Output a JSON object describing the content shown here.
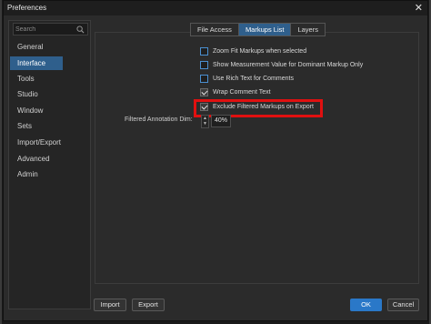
{
  "window": {
    "title": "Preferences",
    "close_glyph": "✕"
  },
  "search": {
    "placeholder": "Search",
    "icon": "search-icon"
  },
  "sidebar": {
    "items": [
      {
        "label": "General",
        "active": false
      },
      {
        "label": "Interface",
        "active": true
      },
      {
        "label": "Tools",
        "active": false
      },
      {
        "label": "Studio",
        "active": false
      },
      {
        "label": "Window",
        "active": false
      },
      {
        "label": "Sets",
        "active": false
      },
      {
        "label": "Import/Export",
        "active": false
      },
      {
        "label": "Advanced",
        "active": false
      },
      {
        "label": "Admin",
        "active": false
      }
    ]
  },
  "tabs": [
    {
      "label": "File Access",
      "active": false
    },
    {
      "label": "Markups List",
      "active": true
    },
    {
      "label": "Layers",
      "active": false
    }
  ],
  "options": [
    {
      "label": "Zoom Fit Markups when selected",
      "checked": false
    },
    {
      "label": "Show Measurement Value for Dominant Markup Only",
      "checked": false
    },
    {
      "label": "Use Rich Text for Comments",
      "checked": false
    },
    {
      "label": "Wrap Comment Text",
      "checked": true
    },
    {
      "label": "Exclude Filtered Markups on Export",
      "checked": true
    }
  ],
  "filtered_dim": {
    "label": "Filtered Annotation Dim:",
    "value": "40%",
    "spin_up": "▲",
    "spin_down": "▼"
  },
  "buttons": {
    "import": "Import",
    "export": "Export",
    "ok": "OK",
    "cancel": "Cancel"
  },
  "colors": {
    "accent": "#2f5f8c",
    "primary_button": "#2a78c8",
    "highlight": "#e01010"
  }
}
